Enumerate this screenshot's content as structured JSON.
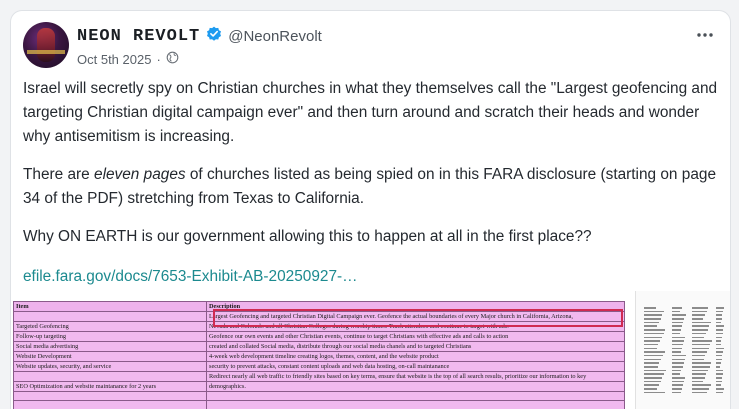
{
  "post": {
    "author": {
      "display_name": "NEON REVOLT",
      "handle": "@NeonRevolt",
      "verified_icon": "verified-check-icon",
      "verified_color": "#1d9bf0"
    },
    "date": "Oct 5th 2025",
    "separator": "·",
    "audience_icon": "globe-icon",
    "more_icon": "more-horizontal-icon",
    "paragraphs": {
      "p1": "Israel will secretly spy on Christian churches in what they themselves call the \"Largest geofencing and targeting Christian digital campaign ever\" and then turn around and scratch their heads and wonder why antisemitism is increasing.",
      "p2_before": "There are ",
      "p2_emphasis": "eleven pages",
      "p2_after": " of churches listed as being spied on in this FARA disclosure (starting on page 34 of the PDF) stretching from Texas to California.",
      "p3": "Why ON EARTH is our government allowing this to happen at all in the first place??"
    },
    "link_text": "efile.fara.gov/docs/7653-Exhibit-AB-20250927-…",
    "link_color": "#1c8a8f"
  },
  "document": {
    "header": {
      "item": "Item",
      "description": "Description"
    },
    "rows": [
      {
        "item": "",
        "description": "Largest Geofencing and targeted Christian Digital Campaign ever. Geofence the actual boundaries of every Major church in California, Arizona,"
      },
      {
        "item": "Targeted Geofencing",
        "description": "Nevada and Colorado and all Christian Colleges during worship times. Track attendees and continue to target with ads."
      },
      {
        "item": "Follow-up targeting",
        "description": "Geofence our own events and other Christian events, continue to target Christians with effective ads and calls to action"
      },
      {
        "item": "Social media advertising",
        "description": "created and collated Social media, distribute through our social media chanels and to targeted Christians"
      },
      {
        "item": "Website Development",
        "description": "4-week web development timeline creating logos, themes, content, and the website product"
      },
      {
        "item": "Website updates, security, and service",
        "description": "security to prevent attacks, constant content uploads and web data hosting, on-call maintanance"
      },
      {
        "item": "",
        "description": "Redirect nearly all web traffic to friendly sites based on key terms, ensure that website is the top of all search results, prioritize our information to key"
      },
      {
        "item": "SEO Optimization and website maintanance for 2 years",
        "description": "demographics."
      },
      {
        "item": "",
        "description": ""
      },
      {
        "item": "",
        "description": ""
      }
    ],
    "table_color": "#f1b9ef",
    "highlight_color": "#d02a52"
  }
}
